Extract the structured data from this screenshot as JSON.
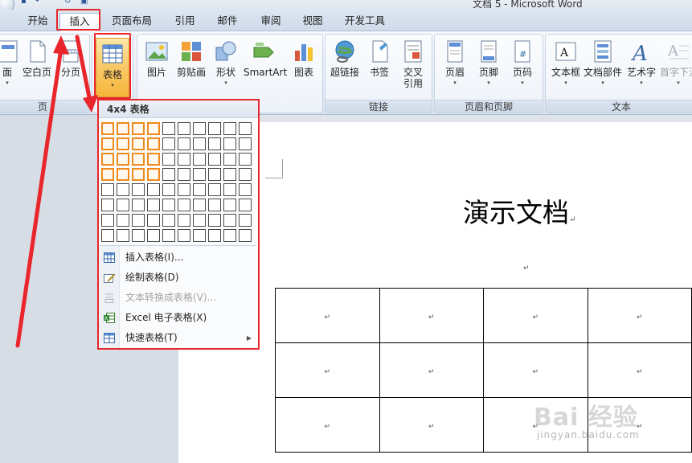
{
  "window": {
    "title": "文档 5 - Microsoft Word"
  },
  "tabs": [
    {
      "label": "开始"
    },
    {
      "label": "插入"
    },
    {
      "label": "页面布局"
    },
    {
      "label": "引用"
    },
    {
      "label": "邮件"
    },
    {
      "label": "审阅"
    },
    {
      "label": "视图"
    },
    {
      "label": "开发工具"
    }
  ],
  "active_tab": "插入",
  "ribbon": {
    "pages_group": {
      "label": "页",
      "buttons": [
        "面",
        "空白页",
        "分页"
      ]
    },
    "tables_group": {
      "button": "表格"
    },
    "illustrations_group": {
      "buttons": [
        "图片",
        "剪贴画",
        "形状",
        "SmartArt",
        "图表"
      ]
    },
    "links_group": {
      "label": "链接",
      "buttons": [
        "超链接",
        "书签",
        "交叉\n引用"
      ]
    },
    "header_footer_group": {
      "label": "页眉和页脚",
      "buttons": [
        "页眉",
        "页脚",
        "页码"
      ]
    },
    "text_group": {
      "label": "文本",
      "buttons": [
        "文本框",
        "文档部件",
        "艺术字",
        "首字下沉"
      ]
    }
  },
  "table_dropdown": {
    "header": "4x4 表格",
    "grid_cols": 10,
    "grid_rows": 8,
    "selected_cols": 4,
    "selected_rows": 4,
    "menu_items": [
      {
        "label": "插入表格(I)...",
        "enabled": true
      },
      {
        "label": "绘制表格(D)",
        "enabled": true
      },
      {
        "label": "文本转换成表格(V)...",
        "enabled": false
      },
      {
        "label": "Excel 电子表格(X)",
        "enabled": true
      },
      {
        "label": "快速表格(T)",
        "enabled": true,
        "submenu": true
      }
    ]
  },
  "document": {
    "title": "演示文档",
    "paragraph_mark": "↵",
    "table": {
      "rows": 3,
      "cols": 4
    }
  },
  "watermark": {
    "brand": "Bai 经验",
    "url": "jingyan.baidu.com"
  },
  "colors": {
    "annotation_red": "#e8262b",
    "selection_orange": "#f08a1c",
    "ribbon_blue": "#a9bcd5"
  }
}
